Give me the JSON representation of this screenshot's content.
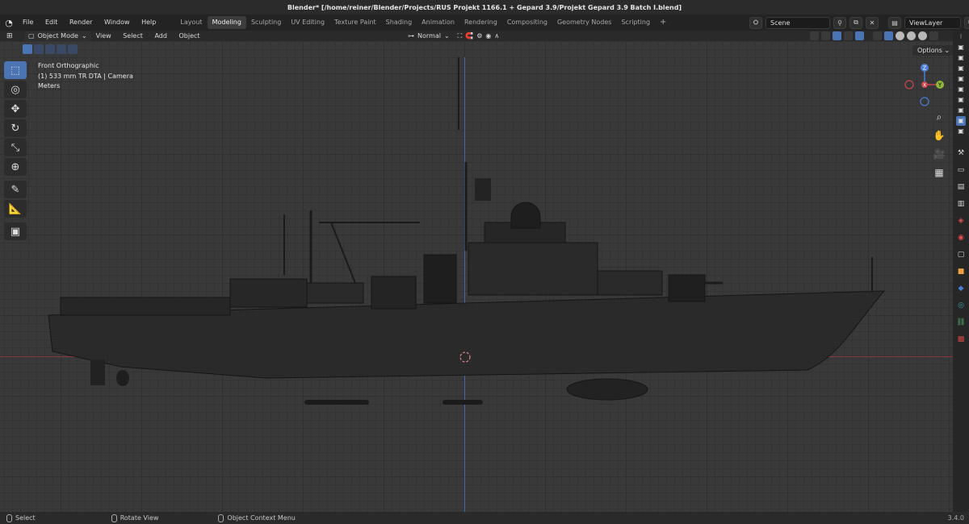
{
  "window_title": "Blender* [/home/reiner/Blender/Projects/RUS Projekt 1166.1 + Gepard 3.9/Projekt Gepard 3.9 Batch I.blend]",
  "menu": [
    "File",
    "Edit",
    "Render",
    "Window",
    "Help"
  ],
  "workspaces": [
    {
      "label": "Layout",
      "active": false
    },
    {
      "label": "Modeling",
      "active": true
    },
    {
      "label": "Sculpting",
      "active": false
    },
    {
      "label": "UV Editing",
      "active": false
    },
    {
      "label": "Texture Paint",
      "active": false
    },
    {
      "label": "Shading",
      "active": false
    },
    {
      "label": "Animation",
      "active": false
    },
    {
      "label": "Rendering",
      "active": false
    },
    {
      "label": "Compositing",
      "active": false
    },
    {
      "label": "Geometry Nodes",
      "active": false
    },
    {
      "label": "Scripting",
      "active": false
    }
  ],
  "add_workspace": "+",
  "scene": {
    "value": "Scene"
  },
  "view_layer": {
    "value": "ViewLayer"
  },
  "viewport_header": {
    "mode": "Object Mode",
    "menus": [
      "View",
      "Select",
      "Add",
      "Object"
    ],
    "orientation": "Normal",
    "options": "Options"
  },
  "overlay": {
    "view_name": "Front Orthographic",
    "collection": "(1) 533 mm TR DTA | Camera",
    "units": "Meters"
  },
  "gizmo": {
    "z": "Z",
    "y": "Y",
    "x": "X"
  },
  "tools": [
    {
      "name": "select-box-tool",
      "icon": "cursor-icon",
      "glyph": "⬚",
      "active": true
    },
    {
      "name": "cursor-tool",
      "icon": "cursor-3d-icon",
      "glyph": "◎",
      "active": false
    },
    {
      "name": "move-tool",
      "icon": "move-icon",
      "glyph": "✥",
      "active": false
    },
    {
      "name": "rotate-tool",
      "icon": "rotate-icon",
      "glyph": "↻",
      "active": false
    },
    {
      "name": "scale-tool",
      "icon": "scale-icon",
      "glyph": "⤡",
      "active": false
    },
    {
      "name": "transform-tool",
      "icon": "transform-icon",
      "glyph": "⊕",
      "active": false
    },
    {
      "name": "annotate-tool",
      "icon": "annotate-icon",
      "glyph": "✎",
      "active": false
    },
    {
      "name": "measure-tool",
      "icon": "measure-icon",
      "glyph": "📐",
      "active": false
    },
    {
      "name": "add-cube-tool",
      "icon": "add-cube-icon",
      "glyph": "▣",
      "active": false
    }
  ],
  "status": {
    "select": "Select",
    "rotate_view": "Rotate View",
    "context_menu": "Object Context Menu",
    "version": "3.4.0"
  },
  "colors": {
    "accent": "#4b74b5",
    "axis_x": "#c8464b",
    "axis_y": "#8fb83a",
    "axis_z": "#4a7fd4",
    "viewport_bg": "#393939"
  }
}
